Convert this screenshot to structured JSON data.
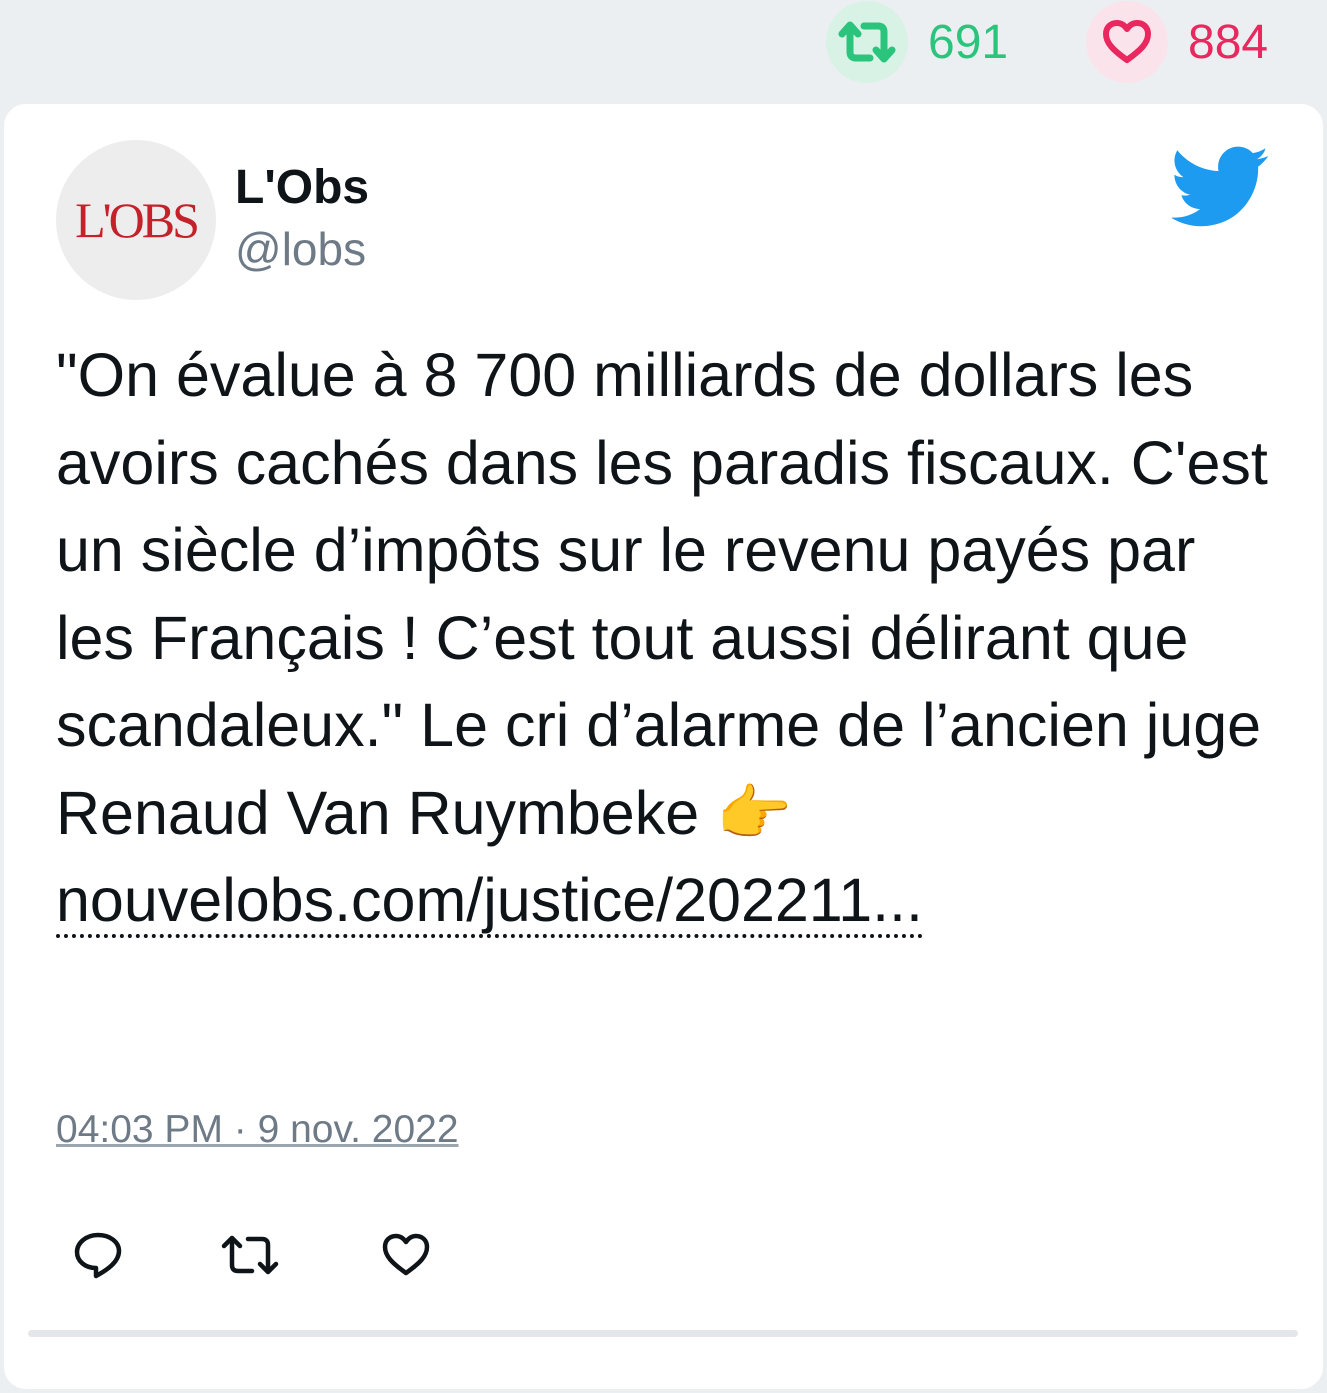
{
  "stats": {
    "retweet_count": "691",
    "like_count": "884",
    "retweet_icon": "retweet-icon",
    "like_icon": "heart-icon"
  },
  "author": {
    "avatar_text": "L'OBS",
    "name": "L'Obs",
    "handle": "@lobs"
  },
  "tweet": {
    "text": "\"On évalue à 8 700 milliards de dollars les avoirs cachés dans les paradis fiscaux. C'est un siècle d’impôts sur le revenu payés par les Français ! C’est tout aussi délirant que scandaleux.\" Le cri d’alarme de l’ancien juge Renaud Van Ruymbeke 👉",
    "link": "nouvelobs.com/justice/202211...",
    "timestamp": "04:03 PM · 9 nov. 2022"
  },
  "colors": {
    "retweet": "#2bc47d",
    "like": "#e8285f",
    "twitter_blue": "#1d9bf0",
    "muted": "#6e7b87"
  }
}
